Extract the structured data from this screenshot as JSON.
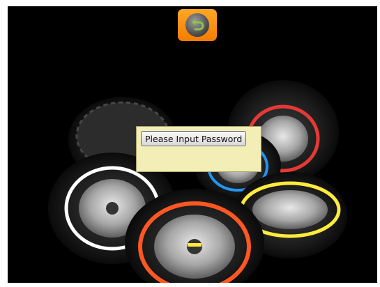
{
  "toolbar": {
    "back_icon": "back-arrow-icon",
    "accent_color": "#f57c00"
  },
  "background": {
    "description_icon": "tires-image",
    "tire_stripe_colors": [
      "#ff5722",
      "#ffffff",
      "#ffeb3b",
      "#e53935",
      "#2196f3",
      "#43a047"
    ]
  },
  "dialog": {
    "button_label": "Please Input Password",
    "background_color": "#f2eeb5"
  }
}
